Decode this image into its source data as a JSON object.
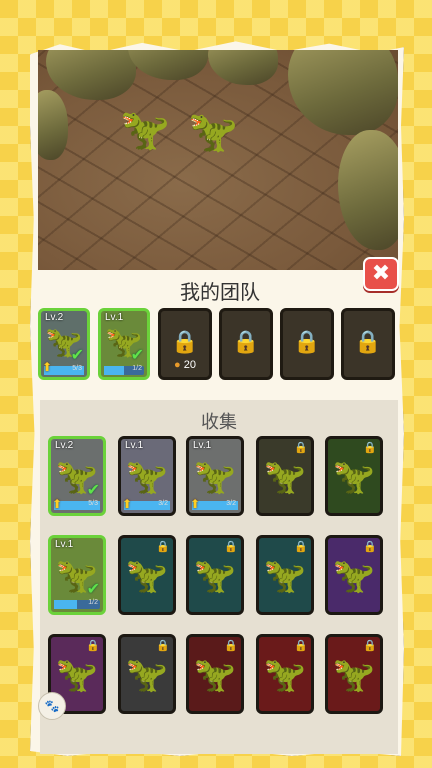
{
  "team": {
    "title": "我的团队",
    "cards": [
      {
        "level": "Lv.2",
        "progress": "5/3",
        "fill": 1.0,
        "bg": "#5f6f6a",
        "dino_color": "#3aa3a0"
      },
      {
        "level": "Lv.1",
        "progress": "1/2",
        "fill": 0.5,
        "bg": "#6a8a3a",
        "dino_color": "#c9a84a"
      }
    ],
    "locked_slots": [
      {
        "cost": "20",
        "coin_icon": "coin-icon"
      },
      {
        "cost": ""
      },
      {
        "cost": ""
      },
      {
        "cost": ""
      }
    ]
  },
  "collection": {
    "title": "收集",
    "cards": [
      {
        "level": "Lv.2",
        "progress": "5/3",
        "fill": 1.0,
        "owned": true,
        "bg": "#6b6f6e",
        "dino_color": "#3aa3a0",
        "check": true,
        "up": true
      },
      {
        "level": "Lv.1",
        "progress": "3/2",
        "fill": 1.0,
        "owned": false,
        "bg": "#6a6a78",
        "dino_color": "#2e78d8",
        "check": false,
        "up": true
      },
      {
        "level": "Lv.1",
        "progress": "3/2",
        "fill": 1.0,
        "owned": false,
        "bg": "#6d6f6e",
        "dino_color": "#3ab86a",
        "check": false,
        "up": true
      },
      {
        "level": "",
        "locked": true,
        "bg": "#3a3a2a",
        "dino_color": "#5a3a8a"
      },
      {
        "level": "",
        "locked": true,
        "bg": "#2f4a1f",
        "dino_color": "#8a5a3a"
      },
      {
        "level": "Lv.1",
        "progress": "1/2",
        "fill": 0.5,
        "owned": true,
        "bg": "#6a8a3a",
        "dino_color": "#c9a84a",
        "check": true,
        "up": false
      },
      {
        "level": "",
        "locked": true,
        "bg": "#1f4a4a",
        "dino_color": "#8a2a8a"
      },
      {
        "level": "",
        "locked": true,
        "bg": "#1f4a4a",
        "dino_color": "#d07a2a"
      },
      {
        "level": "",
        "locked": true,
        "bg": "#1f4a4a",
        "dino_color": "#c0502a"
      },
      {
        "level": "",
        "locked": true,
        "bg": "#4a2a6a",
        "dino_color": "#8a90b0"
      },
      {
        "level": "",
        "locked": true,
        "bg": "#5a2a5a",
        "dino_color": "#9a9a9a"
      },
      {
        "level": "",
        "locked": true,
        "bg": "#3a3a3a",
        "dino_color": "#1a1a1a"
      },
      {
        "level": "",
        "locked": true,
        "bg": "#5a1a1a",
        "dino_color": "#1a1a1a"
      },
      {
        "level": "",
        "locked": true,
        "bg": "#6a1a1a",
        "dino_color": "#b04a20"
      },
      {
        "level": "",
        "locked": true,
        "bg": "#6a1a1a",
        "dino_color": "#7a9ac0"
      }
    ]
  },
  "close_label": "✖"
}
